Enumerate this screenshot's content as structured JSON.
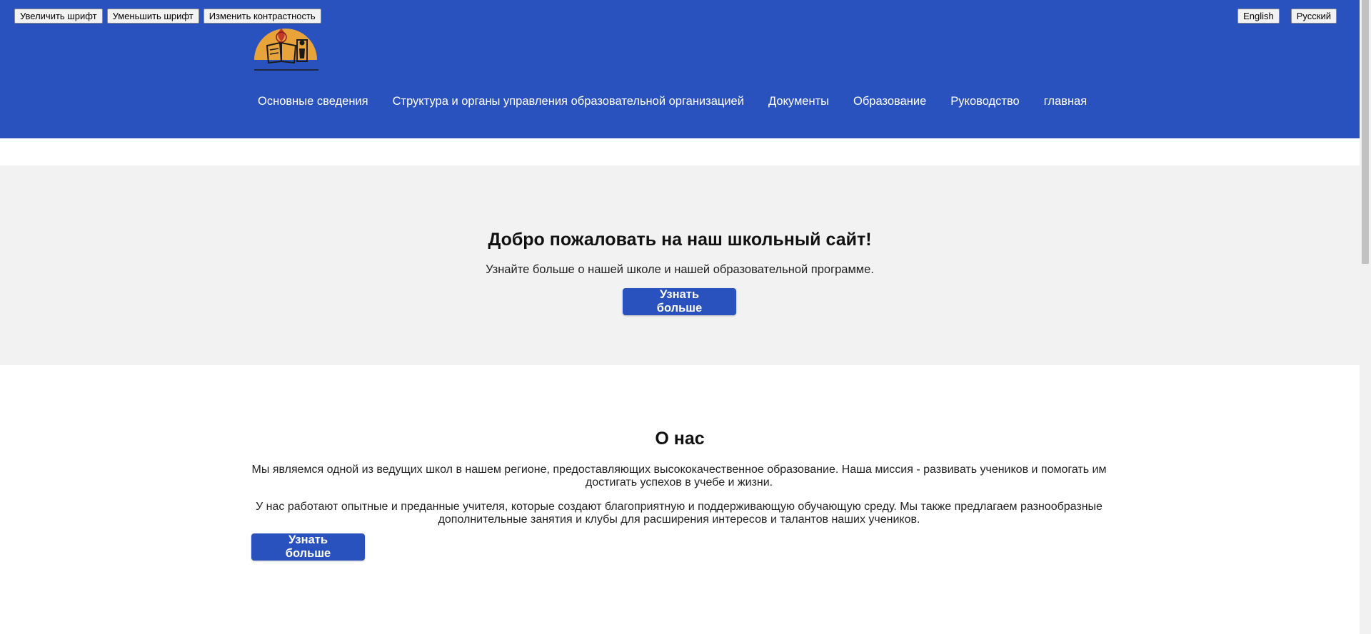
{
  "accessibility": {
    "increase_font": "Увеличить шрифт",
    "decrease_font": "Уменьшить шрифт",
    "change_contrast": "Изменить контрастность"
  },
  "language": {
    "english": "English",
    "russian": "Русский"
  },
  "nav": {
    "items": [
      "Основные сведения",
      "Структура и органы управления образовательной организацией",
      "Документы",
      "Образование",
      "Руководство",
      "главная"
    ]
  },
  "hero": {
    "title": "Добро пожаловать на наш школьный сайт!",
    "subtitle": "Узнайте больше о нашей школе и нашей образовательной программе.",
    "button": "Узнать больше"
  },
  "about": {
    "title": "О нас",
    "paragraph1": "Мы являемся одной из ведущих школ в нашем регионе, предоставляющих высококачественное образование. Наша миссия - развивать учеников и помогать им достигать успехов в учебе и жизни.",
    "paragraph2": "У нас работают опытные и преданные учителя, которые создают благоприятную и поддерживающую обучающую среду. Мы также предлагаем разнообразные дополнительные занятия и клубы для расширения интересов и талантов наших учеников.",
    "button": "Узнать больше"
  },
  "colors": {
    "header_bg": "#2a52be",
    "hero_bg": "#f2f2f2",
    "logo_orange": "#e8a33a",
    "logo_red": "#c0392b"
  },
  "icons": {
    "logo": "school-book-logo-icon"
  }
}
